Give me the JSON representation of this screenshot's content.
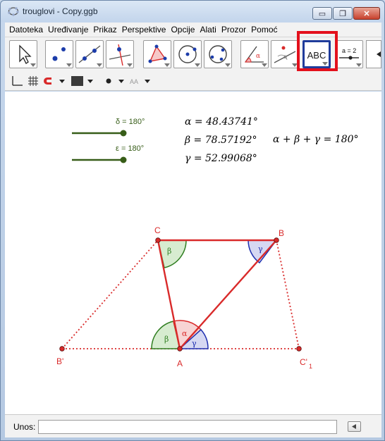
{
  "window": {
    "title": "trouglovi - Copy.ggb",
    "close_glyph": "✕",
    "min_glyph": "▭",
    "max_glyph": "❐"
  },
  "menu": [
    "Datoteka",
    "Uređivanje",
    "Prikaz",
    "Perspektive",
    "Opcije",
    "Alati",
    "Prozor",
    "Pomoć"
  ],
  "toolbar": {
    "tools": [
      "move-tool",
      "point-tool",
      "line-tool",
      "perpendicular-line-tool",
      "polygon-tool",
      "circle-tool",
      "conic-tool",
      "angle-tool",
      "reflect-tool",
      "text-tool",
      "slider-tool"
    ],
    "text_tool_label": "ABC",
    "slider_tool_label": "a = 2",
    "angle_glyph": "α",
    "reflect_glyph": "a",
    "highlight_color": "#e3101c"
  },
  "graphics": {
    "sliders": [
      {
        "label": "δ = 180°"
      },
      {
        "label": "ε = 180°"
      }
    ],
    "angles_text": {
      "alpha": "α = 48.43741°",
      "beta": "β = 78.57192°",
      "gamma": "γ = 52.99068°",
      "sum": "α + β + γ = 180°"
    },
    "points": {
      "A": "A",
      "B": "B",
      "C": "C",
      "B1": "B'",
      "C1_main": "C'",
      "C1_sub": "1"
    },
    "angle_marks": {
      "alpha": "α",
      "beta": "β",
      "gamma": "γ"
    },
    "colors": {
      "triangle": "#d92a2a",
      "beta_fill": "#2e7d1f",
      "gamma_fill": "#1e2fb0",
      "alpha_fill": "#d92a2a",
      "slider": "#375d18"
    }
  },
  "input_bar": {
    "label": "Unos:",
    "value": ""
  }
}
